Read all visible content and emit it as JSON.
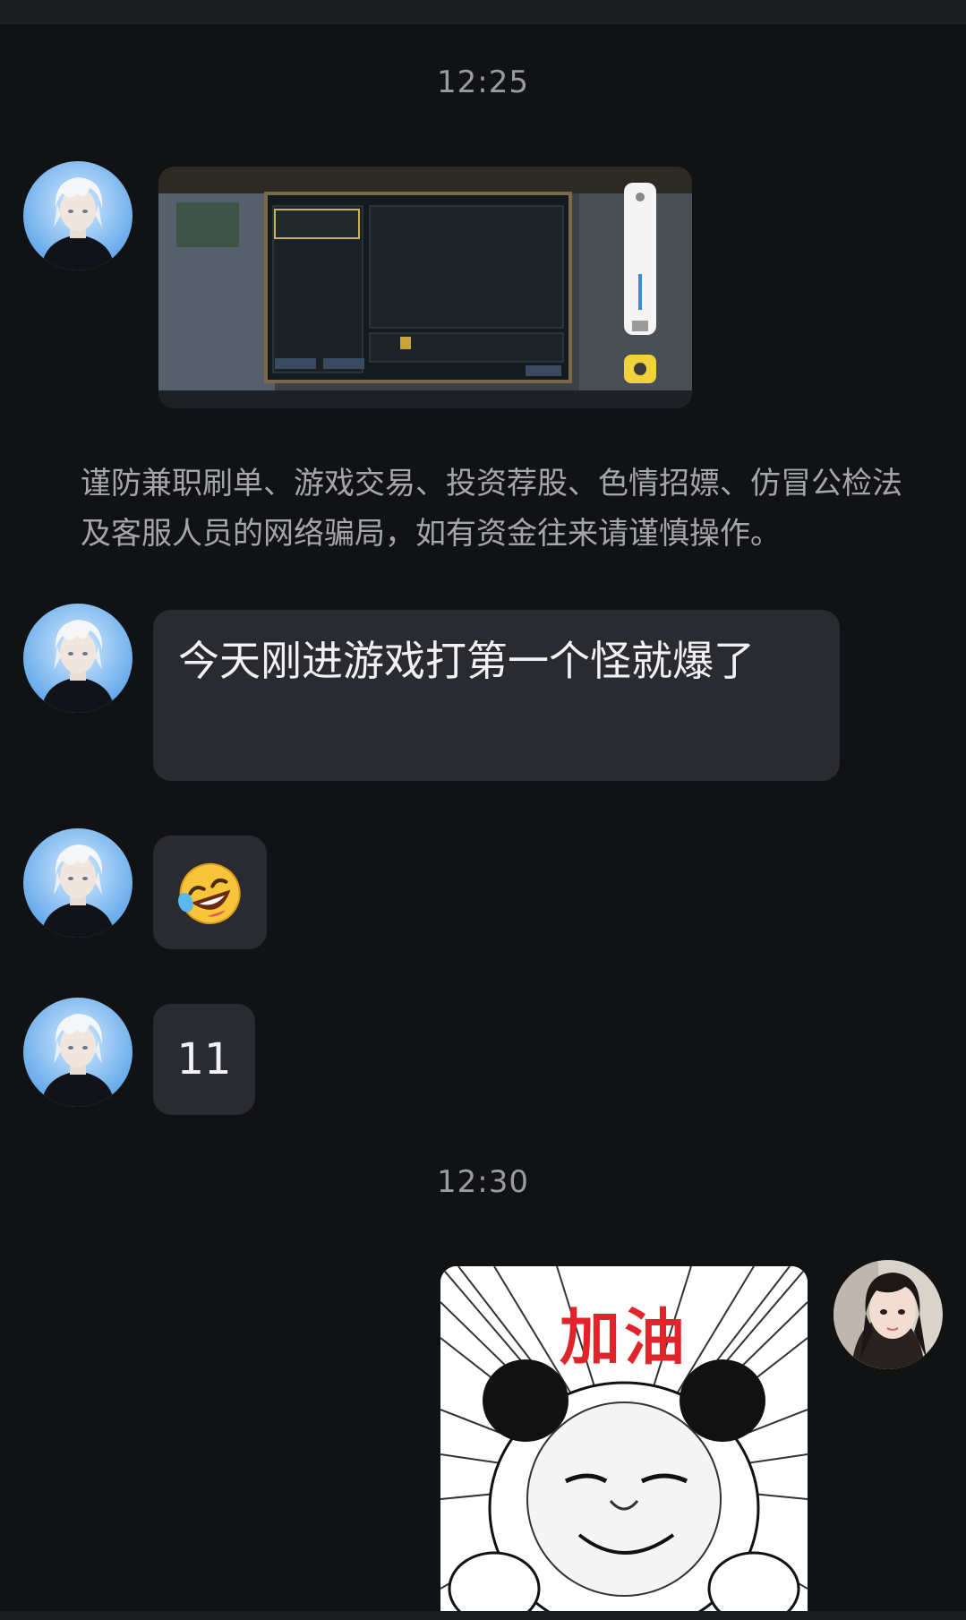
{
  "time_1": "12:25",
  "time_2": "12:30",
  "notice": "谨防兼职刷单、游戏交易、投资荐股、色情招嫖、仿冒公检法及客服人员的网络骗局，如有资金往来请谨慎操作。",
  "messages": {
    "text_1": "今天刚进游戏打第一个怪就爆了",
    "text_2": "11"
  },
  "sticker": {
    "caption": "加油"
  },
  "icons": {
    "emoji": "laughing-tears-emoji-icon",
    "volume": "speaker-icon",
    "notify": "notification-off-icon"
  },
  "colors": {
    "background": "#111214",
    "bubble": "#2a2b30",
    "sticker_text": "#e0242a"
  }
}
